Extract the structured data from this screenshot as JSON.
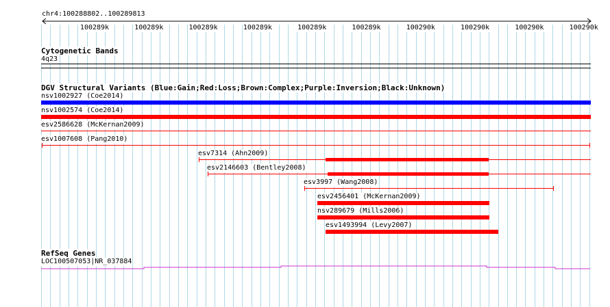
{
  "ruler": {
    "location": "chr4:100288802..100289813",
    "ticks": [
      "100289k",
      "100289k",
      "100289k",
      "100289k",
      "100289k",
      "100289k",
      "100290k",
      "100290k",
      "100290k",
      "100290k"
    ]
  },
  "cytoband": {
    "title": "Cytogenetic Bands",
    "band": "4q23"
  },
  "dgv": {
    "title": "DGV Structural Variants (Blue:Gain;Red:Loss;Brown:Complex;Purple:Inversion;Black:Unknown)",
    "variants": [
      {
        "label": "nsv1002927 (Coe2014)",
        "color": "#0000ff",
        "type": "Gain"
      },
      {
        "label": "nsv1002574 (Coe2014)",
        "color": "#ff0000",
        "type": "Loss"
      },
      {
        "label": "esv2586628 (McKernan2009)",
        "color": "#ff0000",
        "type": "Loss"
      },
      {
        "label": "esv1007608 (Pang2010)",
        "color": "#ff0000",
        "type": "Loss"
      },
      {
        "label": "esv7314 (Ahn2009)",
        "color": "#ff0000",
        "type": "Loss"
      },
      {
        "label": "esv2146603 (Bentley2008)",
        "color": "#ff0000",
        "type": "Loss"
      },
      {
        "label": "esv3997 (Wang2008)",
        "color": "#ff0000",
        "type": "Loss"
      },
      {
        "label": "esv2456401 (McKernan2009)",
        "color": "#ff0000",
        "type": "Loss"
      },
      {
        "label": "nsv289679 (Mills2006)",
        "color": "#ff0000",
        "type": "Loss"
      },
      {
        "label": "esv1493994 (Levy2007)",
        "color": "#ff0000",
        "type": "Loss"
      }
    ]
  },
  "refseq": {
    "title": "RefSeq Genes",
    "gene_label": "LOC100507053|NR_037884",
    "color": "#cc33cc"
  },
  "colors": {
    "grid": "#add8e6",
    "gain": "#0000ff",
    "loss": "#ff0000",
    "text": "#000000",
    "gene": "#cc33cc"
  }
}
